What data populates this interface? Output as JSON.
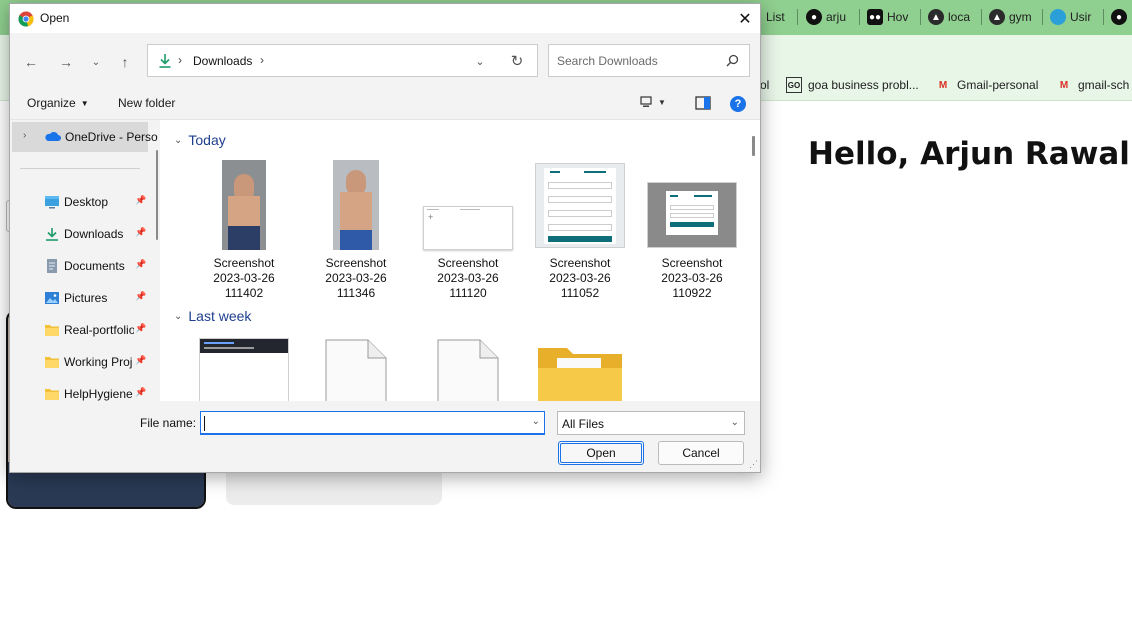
{
  "browser": {
    "tabs": [
      {
        "label": "List",
        "icon": "list-icon",
        "color": "#4a4a4a"
      },
      {
        "label": "arju",
        "icon": "github-icon",
        "color": "#111111"
      },
      {
        "label": "Hov",
        "icon": "medium-icon",
        "color": "#111111"
      },
      {
        "label": "loca",
        "icon": "triangle-icon",
        "color": "#2b2b2b"
      },
      {
        "label": "gym",
        "icon": "triangle-icon",
        "color": "#2b2b2b"
      },
      {
        "label": "Usir",
        "icon": "app-icon",
        "color": "#2a9fd8"
      },
      {
        "label": "",
        "icon": "github-icon",
        "color": "#111111"
      }
    ],
    "bookmarks": [
      {
        "label": "ol",
        "icon": ""
      },
      {
        "label": "goa business probl...",
        "icon": "go-icon"
      },
      {
        "label": "Gmail-personal",
        "icon": "gmail-icon"
      },
      {
        "label": "gmail-sch",
        "icon": "gmail-icon"
      }
    ],
    "page_heading": "Hello, Arjun Rawal"
  },
  "dialog": {
    "title": "Open",
    "address": {
      "path": "Downloads"
    },
    "search": {
      "placeholder": "Search Downloads"
    },
    "toolbar": {
      "organize": "Organize",
      "new_folder": "New folder",
      "help": "?"
    },
    "nav": {
      "onedrive": "OneDrive - Perso",
      "items": [
        {
          "label": "Desktop",
          "icon": "desktop-icon"
        },
        {
          "label": "Downloads",
          "icon": "download-icon"
        },
        {
          "label": "Documents",
          "icon": "documents-icon"
        },
        {
          "label": "Pictures",
          "icon": "pictures-icon"
        },
        {
          "label": "Real-portfolio",
          "icon": "folder-icon"
        },
        {
          "label": "Working Proj",
          "icon": "folder-icon"
        },
        {
          "label": "HelpHygiene",
          "icon": "folder-icon"
        }
      ]
    },
    "groups": [
      {
        "name": "Today",
        "files": [
          {
            "line1": "Screenshot",
            "line2": "2023-03-26",
            "line3": "111402"
          },
          {
            "line1": "Screenshot",
            "line2": "2023-03-26",
            "line3": "111346"
          },
          {
            "line1": "Screenshot",
            "line2": "2023-03-26",
            "line3": "111120"
          },
          {
            "line1": "Screenshot",
            "line2": "2023-03-26",
            "line3": "111052"
          },
          {
            "line1": "Screenshot",
            "line2": "2023-03-26",
            "line3": "110922"
          }
        ]
      },
      {
        "name": "Last week",
        "files": []
      }
    ],
    "bottom": {
      "file_name_label": "File name:",
      "file_name_value": "",
      "filter": "All Files",
      "open": "Open",
      "cancel": "Cancel"
    }
  }
}
